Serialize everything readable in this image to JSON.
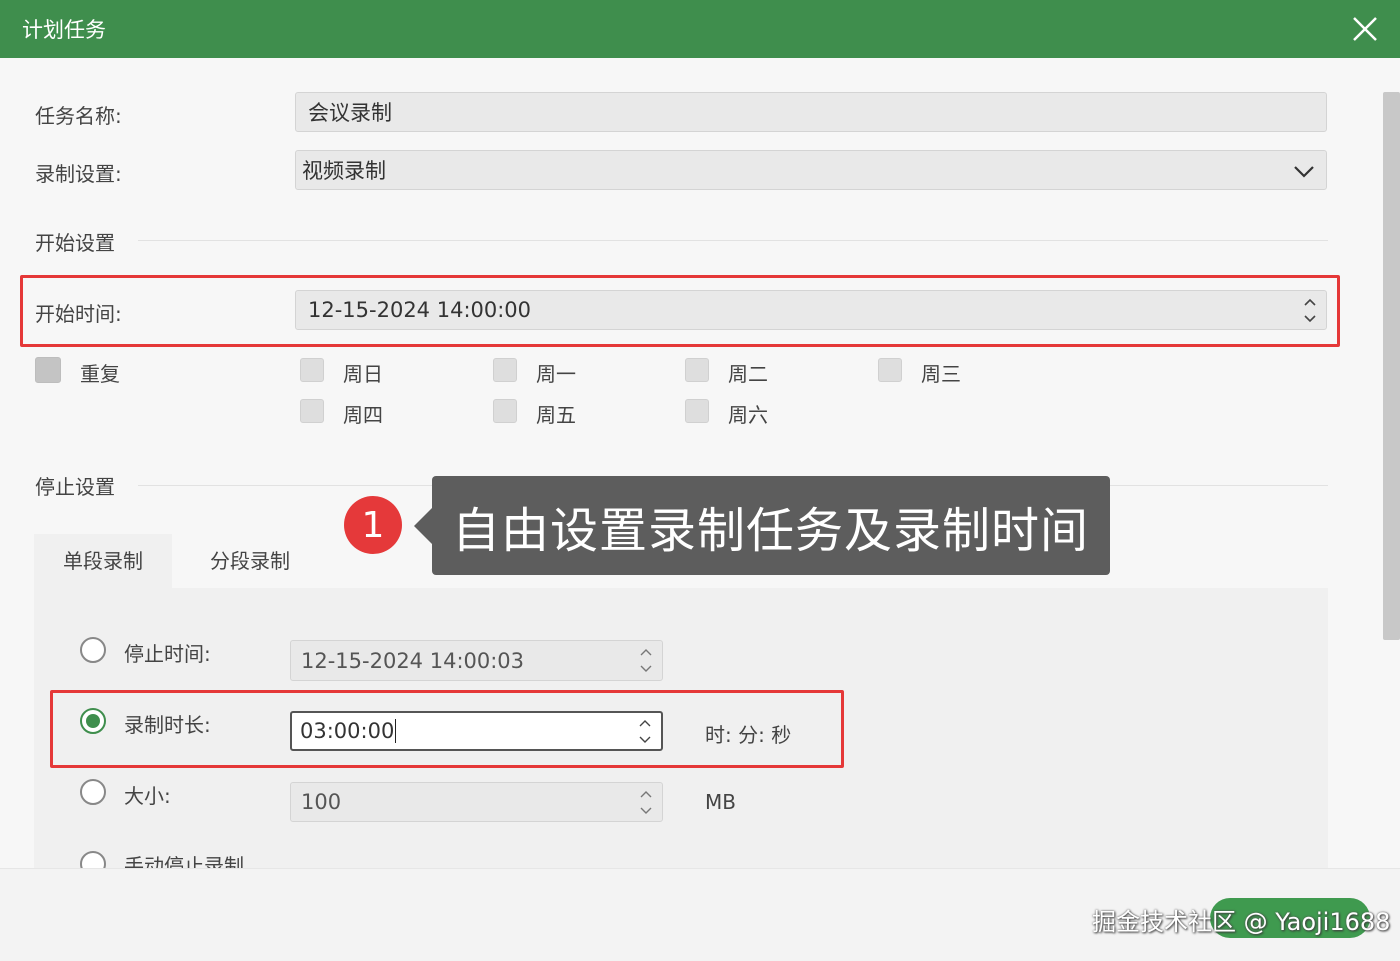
{
  "window": {
    "title": "计划任务"
  },
  "form": {
    "task_name_label": "任务名称:",
    "task_name_value": "会议录制",
    "record_setting_label": "录制设置:",
    "record_setting_value": "视频录制"
  },
  "start": {
    "section_title": "开始设置",
    "start_time_label": "开始时间:",
    "start_time_value": "12-15-2024 14:00:00",
    "repeat_label": "重复",
    "weekdays": [
      "周日",
      "周一",
      "周二",
      "周三",
      "周四",
      "周五",
      "周六"
    ]
  },
  "stop": {
    "section_title": "停止设置",
    "tabs": [
      "单段录制",
      "分段录制"
    ],
    "stop_time_label": "停止时间:",
    "stop_time_value": "12-15-2024 14:00:03",
    "duration_label": "录制时长:",
    "duration_value": "03:00:00",
    "duration_unit": "时: 分: 秒",
    "size_label": "大小:",
    "size_value": "100",
    "size_unit": "MB",
    "manual_label": "手动停止录制"
  },
  "annotation": {
    "badge": "1",
    "text": "自由设置录制任务及录制时间"
  },
  "watermark": "掘金技术社区 @ Yaoji1688",
  "colors": {
    "accent": "#3f8e4d",
    "highlight": "#e53838",
    "callout": "#5d5d5d"
  }
}
